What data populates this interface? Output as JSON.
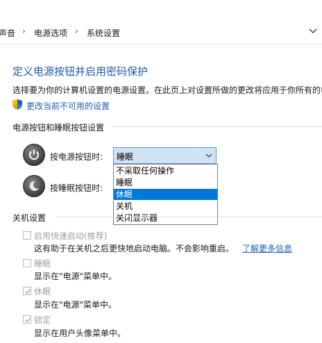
{
  "breadcrumb": {
    "items": [
      "声音",
      "电源选项",
      "系统设置"
    ],
    "separator": "›"
  },
  "page": {
    "title": "定义电源按钮并启用密码保护",
    "description": "选择要为你的计算机设置的电源设置。在此页上对设置所做的更改将应用于你所有的电",
    "change_link": "更改当前不可用的设置"
  },
  "power_section": {
    "heading": "电源按钮和睡眠按钮设置",
    "power_button_label": "按电源按钮时:",
    "power_button_value": "睡眠",
    "sleep_button_label": "按睡眠按钮时:",
    "options": [
      "不采取任何操作",
      "睡眠",
      "休眠",
      "关机",
      "关闭显示器"
    ],
    "highlighted_option": "休眠"
  },
  "shutdown_section": {
    "heading": "关机设置",
    "items": [
      {
        "label": "启用快速启动(推荐)",
        "desc": "这有助于在关机之后更快地启动电脑。不会影响重启。",
        "link": "了解更多信息",
        "checked": false
      },
      {
        "label": "睡眠",
        "desc": "显示在\"电源\"菜单中。",
        "checked": false
      },
      {
        "label": "休眠",
        "desc": "显示在\"电源\"菜单中。",
        "checked": true
      },
      {
        "label": "锁定",
        "desc": "显示在用户头像菜单中。",
        "checked": true
      }
    ]
  },
  "colors": {
    "accent": "#0078d7",
    "link": "#1f5fb4",
    "title": "#1e5aa8",
    "select_bg": "#cfe3f5"
  }
}
